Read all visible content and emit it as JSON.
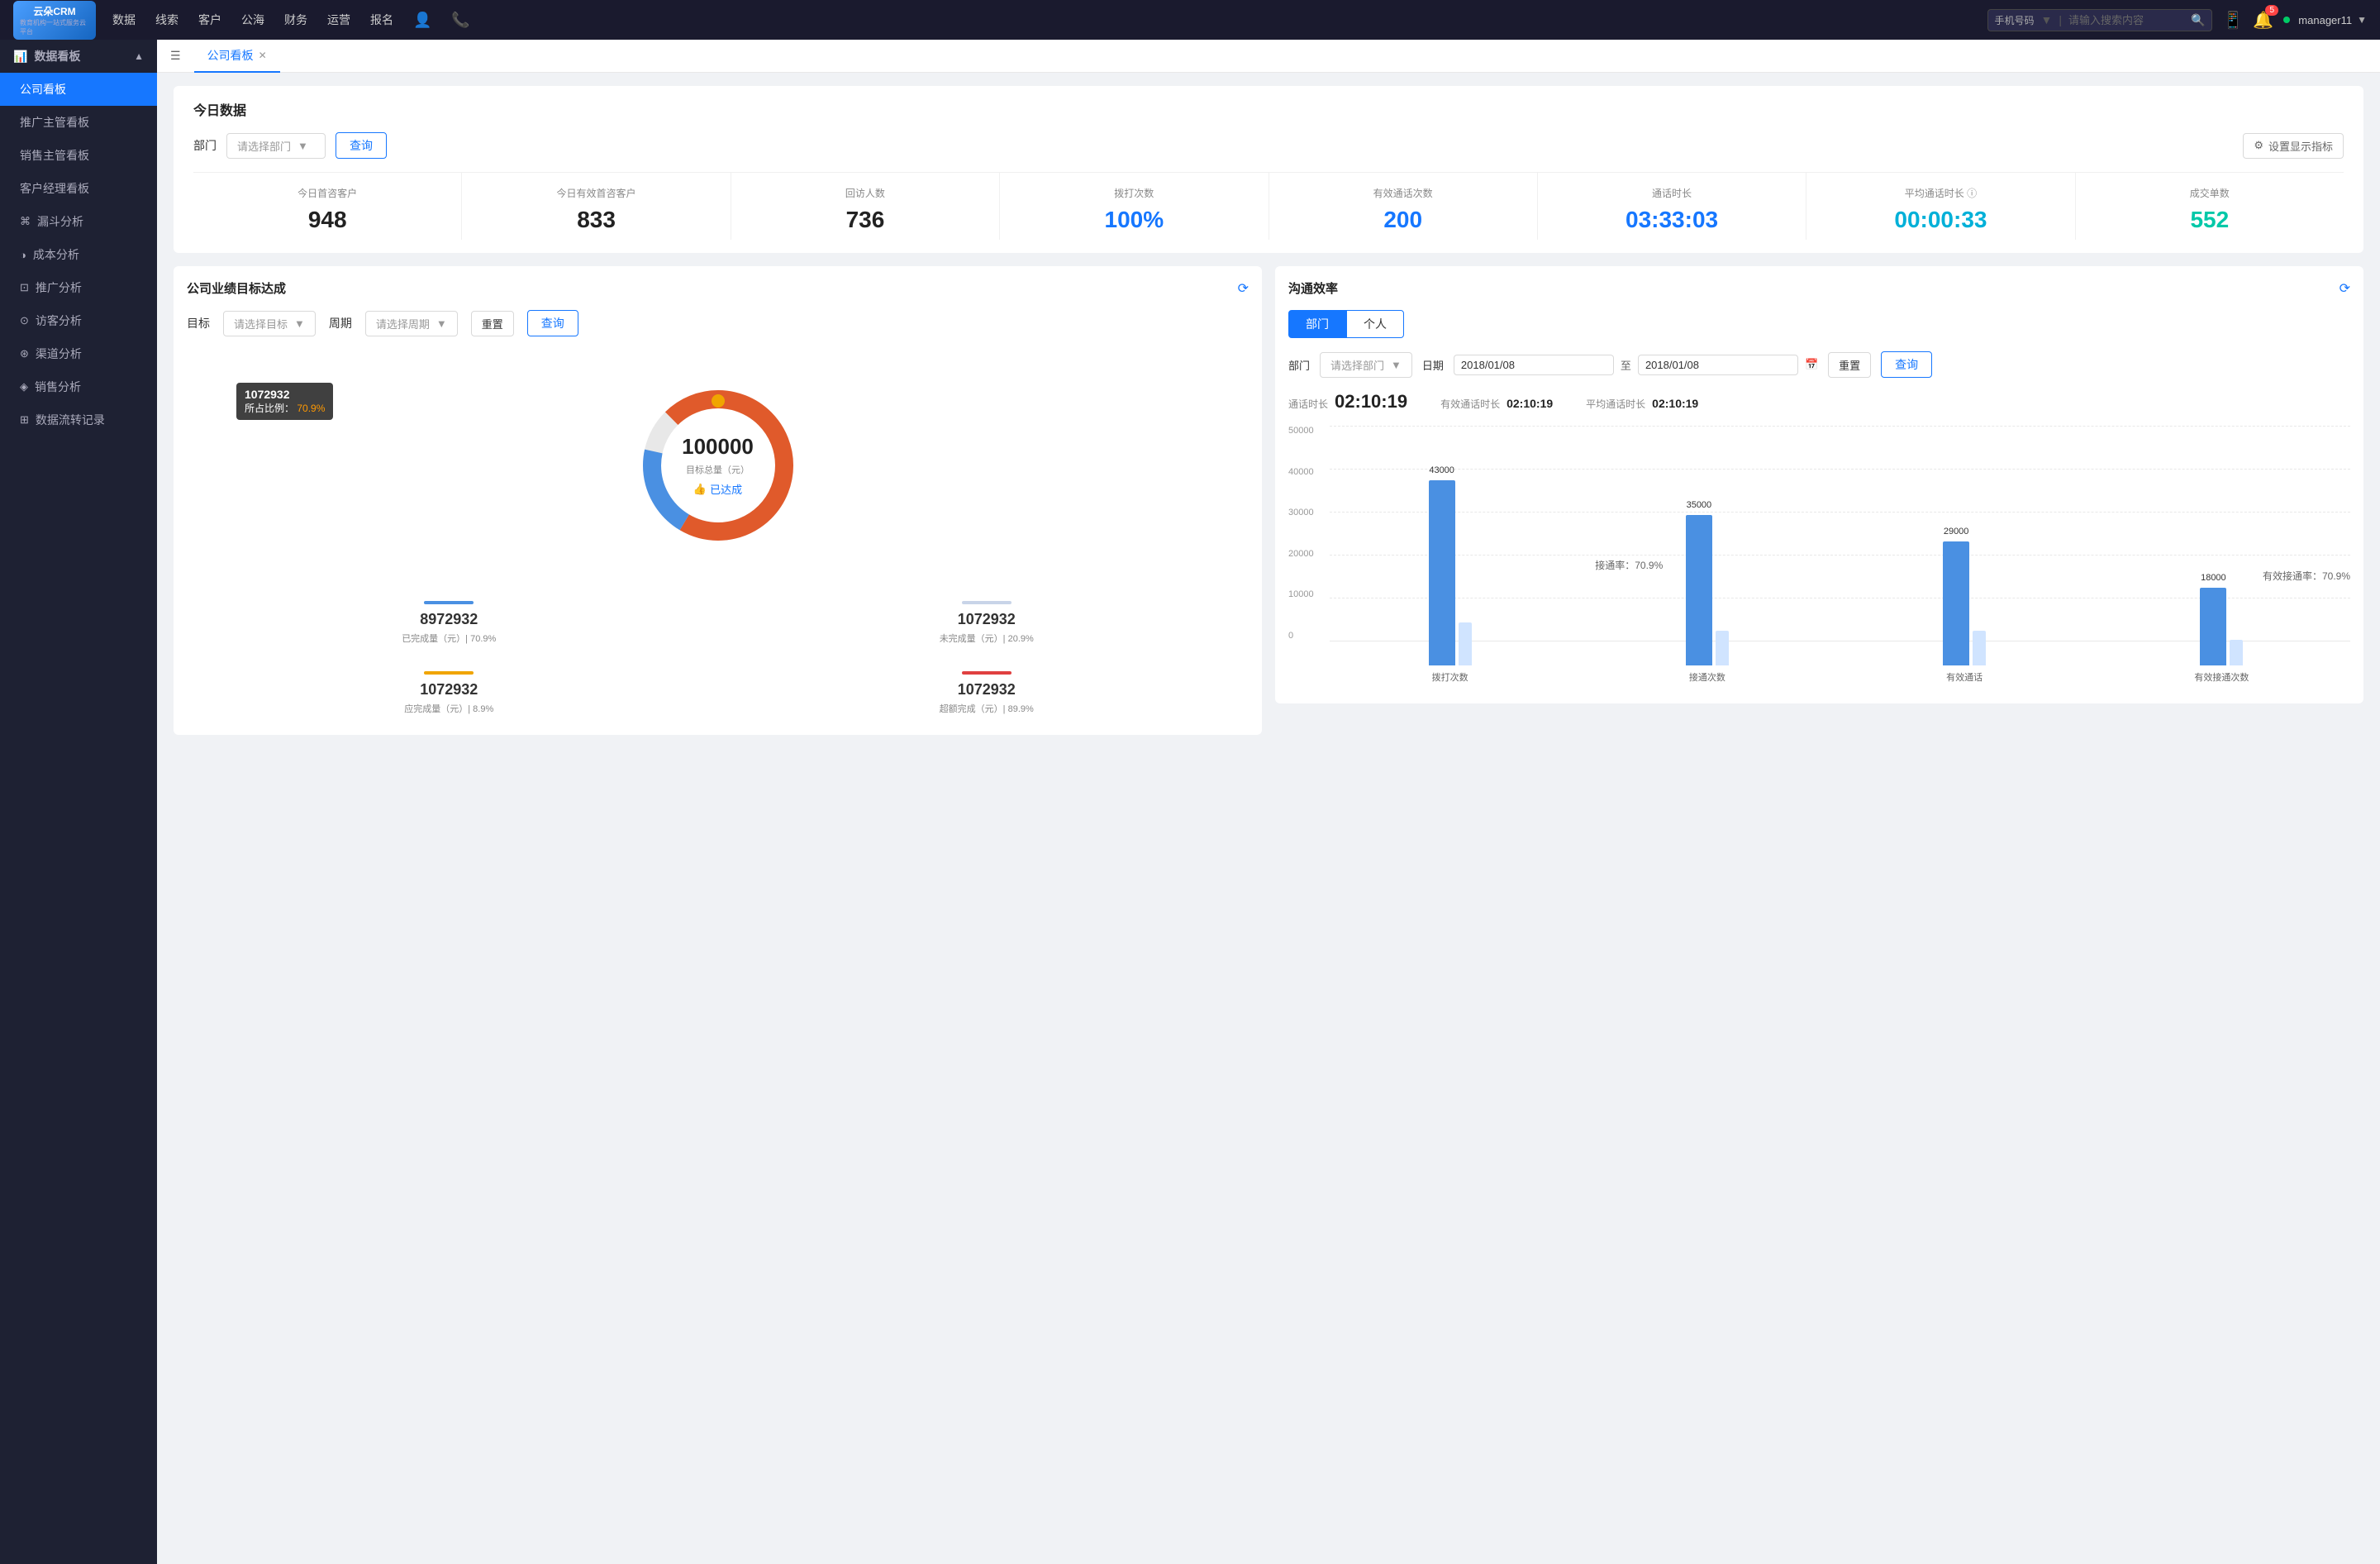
{
  "app": {
    "logo_line1": "云朵CRM",
    "logo_line2": "教育机构一站式服务云平台"
  },
  "top_nav": {
    "items": [
      "数据",
      "线索",
      "客户",
      "公海",
      "财务",
      "运营",
      "报名"
    ],
    "search_placeholder": "请输入搜索内容",
    "search_type": "手机号码",
    "notification_count": "5",
    "username": "manager11"
  },
  "sidebar": {
    "group_label": "数据看板",
    "items": [
      {
        "label": "公司看板",
        "active": true
      },
      {
        "label": "推广主管看板",
        "active": false
      },
      {
        "label": "销售主管看板",
        "active": false
      },
      {
        "label": "客户经理看板",
        "active": false
      },
      {
        "label": "漏斗分析",
        "active": false
      },
      {
        "label": "成本分析",
        "active": false
      },
      {
        "label": "推广分析",
        "active": false
      },
      {
        "label": "访客分析",
        "active": false
      },
      {
        "label": "渠道分析",
        "active": false
      },
      {
        "label": "销售分析",
        "active": false
      },
      {
        "label": "数据流转记录",
        "active": false
      }
    ]
  },
  "tab_bar": {
    "menu_icon": "☰",
    "tabs": [
      {
        "label": "公司看板",
        "active": true,
        "closable": true
      }
    ]
  },
  "today_data": {
    "section_title": "今日数据",
    "dept_label": "部门",
    "dept_placeholder": "请选择部门",
    "query_btn": "查询",
    "settings_label": "设置显示指标",
    "metrics": [
      {
        "label": "今日首咨客户",
        "value": "948",
        "color": "black"
      },
      {
        "label": "今日有效首咨客户",
        "value": "833",
        "color": "black"
      },
      {
        "label": "回访人数",
        "value": "736",
        "color": "black"
      },
      {
        "label": "拨打次数",
        "value": "100%",
        "color": "blue"
      },
      {
        "label": "有效通话次数",
        "value": "200",
        "color": "blue"
      },
      {
        "label": "通话时长",
        "value": "03:33:03",
        "color": "blue"
      },
      {
        "label": "平均通话时长",
        "value": "00:00:33",
        "color": "cyan"
      },
      {
        "label": "成交单数",
        "value": "552",
        "color": "teal"
      }
    ]
  },
  "goal_card": {
    "title": "公司业绩目标达成",
    "goal_label": "目标",
    "goal_placeholder": "请选择目标",
    "period_label": "周期",
    "period_placeholder": "请选择周期",
    "reset_btn": "重置",
    "query_btn": "查询",
    "tooltip_value": "1072932",
    "tooltip_percent_label": "所占比例：",
    "tooltip_percent": "70.9%",
    "donut_center_value": "100000",
    "donut_center_label": "目标总量（元）",
    "donut_achieved": "已达成",
    "metrics": [
      {
        "bar_color": "#4a90e2",
        "value": "8972932",
        "desc": "已完成量（元）| 70.9%"
      },
      {
        "bar_color": "#d0d8e8",
        "value": "1072932",
        "desc": "未完成量（元）| 20.9%"
      },
      {
        "bar_color": "#f0a500",
        "value": "1072932",
        "desc": "应完成量（元）| 8.9%"
      },
      {
        "bar_color": "#e04040",
        "value": "1072932",
        "desc": "超额完成（元）| 89.9%"
      }
    ]
  },
  "comm_card": {
    "title": "沟通效率",
    "dept_tab": "部门",
    "personal_tab": "个人",
    "dept_label": "部门",
    "dept_placeholder": "请选择部门",
    "date_label": "日期",
    "date_from": "2018/01/08",
    "date_to": "2018/01/08",
    "reset_btn": "重置",
    "query_btn": "查询",
    "stats": [
      {
        "label": "通话时长",
        "value": "02:10:19"
      },
      {
        "label": "有效通话时长",
        "value": "02:10:19"
      },
      {
        "label": "平均通话时长",
        "value": "02:10:19"
      }
    ],
    "chart": {
      "y_labels": [
        "50000",
        "40000",
        "30000",
        "20000",
        "10000",
        "0"
      ],
      "groups": [
        {
          "label": "拨打次数",
          "bars": [
            {
              "value": 43000,
              "label": "43000",
              "color": "#4a90e2",
              "height_pct": 86
            },
            {
              "value": 10000,
              "label": "",
              "color": "#d0e4ff",
              "height_pct": 20
            }
          ]
        },
        {
          "label": "接通次数",
          "bars": [
            {
              "value": 35000,
              "label": "35000",
              "color": "#4a90e2",
              "height_pct": 70
            },
            {
              "value": 8000,
              "label": "",
              "color": "#d0e4ff",
              "height_pct": 16
            }
          ],
          "annotation": "接通率：70.9%"
        },
        {
          "label": "有效通话",
          "bars": [
            {
              "value": 29000,
              "label": "29000",
              "color": "#4a90e2",
              "height_pct": 58
            },
            {
              "value": 8000,
              "label": "",
              "color": "#d0e4ff",
              "height_pct": 16
            }
          ]
        },
        {
          "label": "有效接通次数",
          "bars": [
            {
              "value": 18000,
              "label": "18000",
              "color": "#4a90e2",
              "height_pct": 36
            },
            {
              "value": 6000,
              "label": "",
              "color": "#d0e4ff",
              "height_pct": 12
            }
          ],
          "annotation": "有效接通率：70.9%"
        }
      ]
    }
  }
}
